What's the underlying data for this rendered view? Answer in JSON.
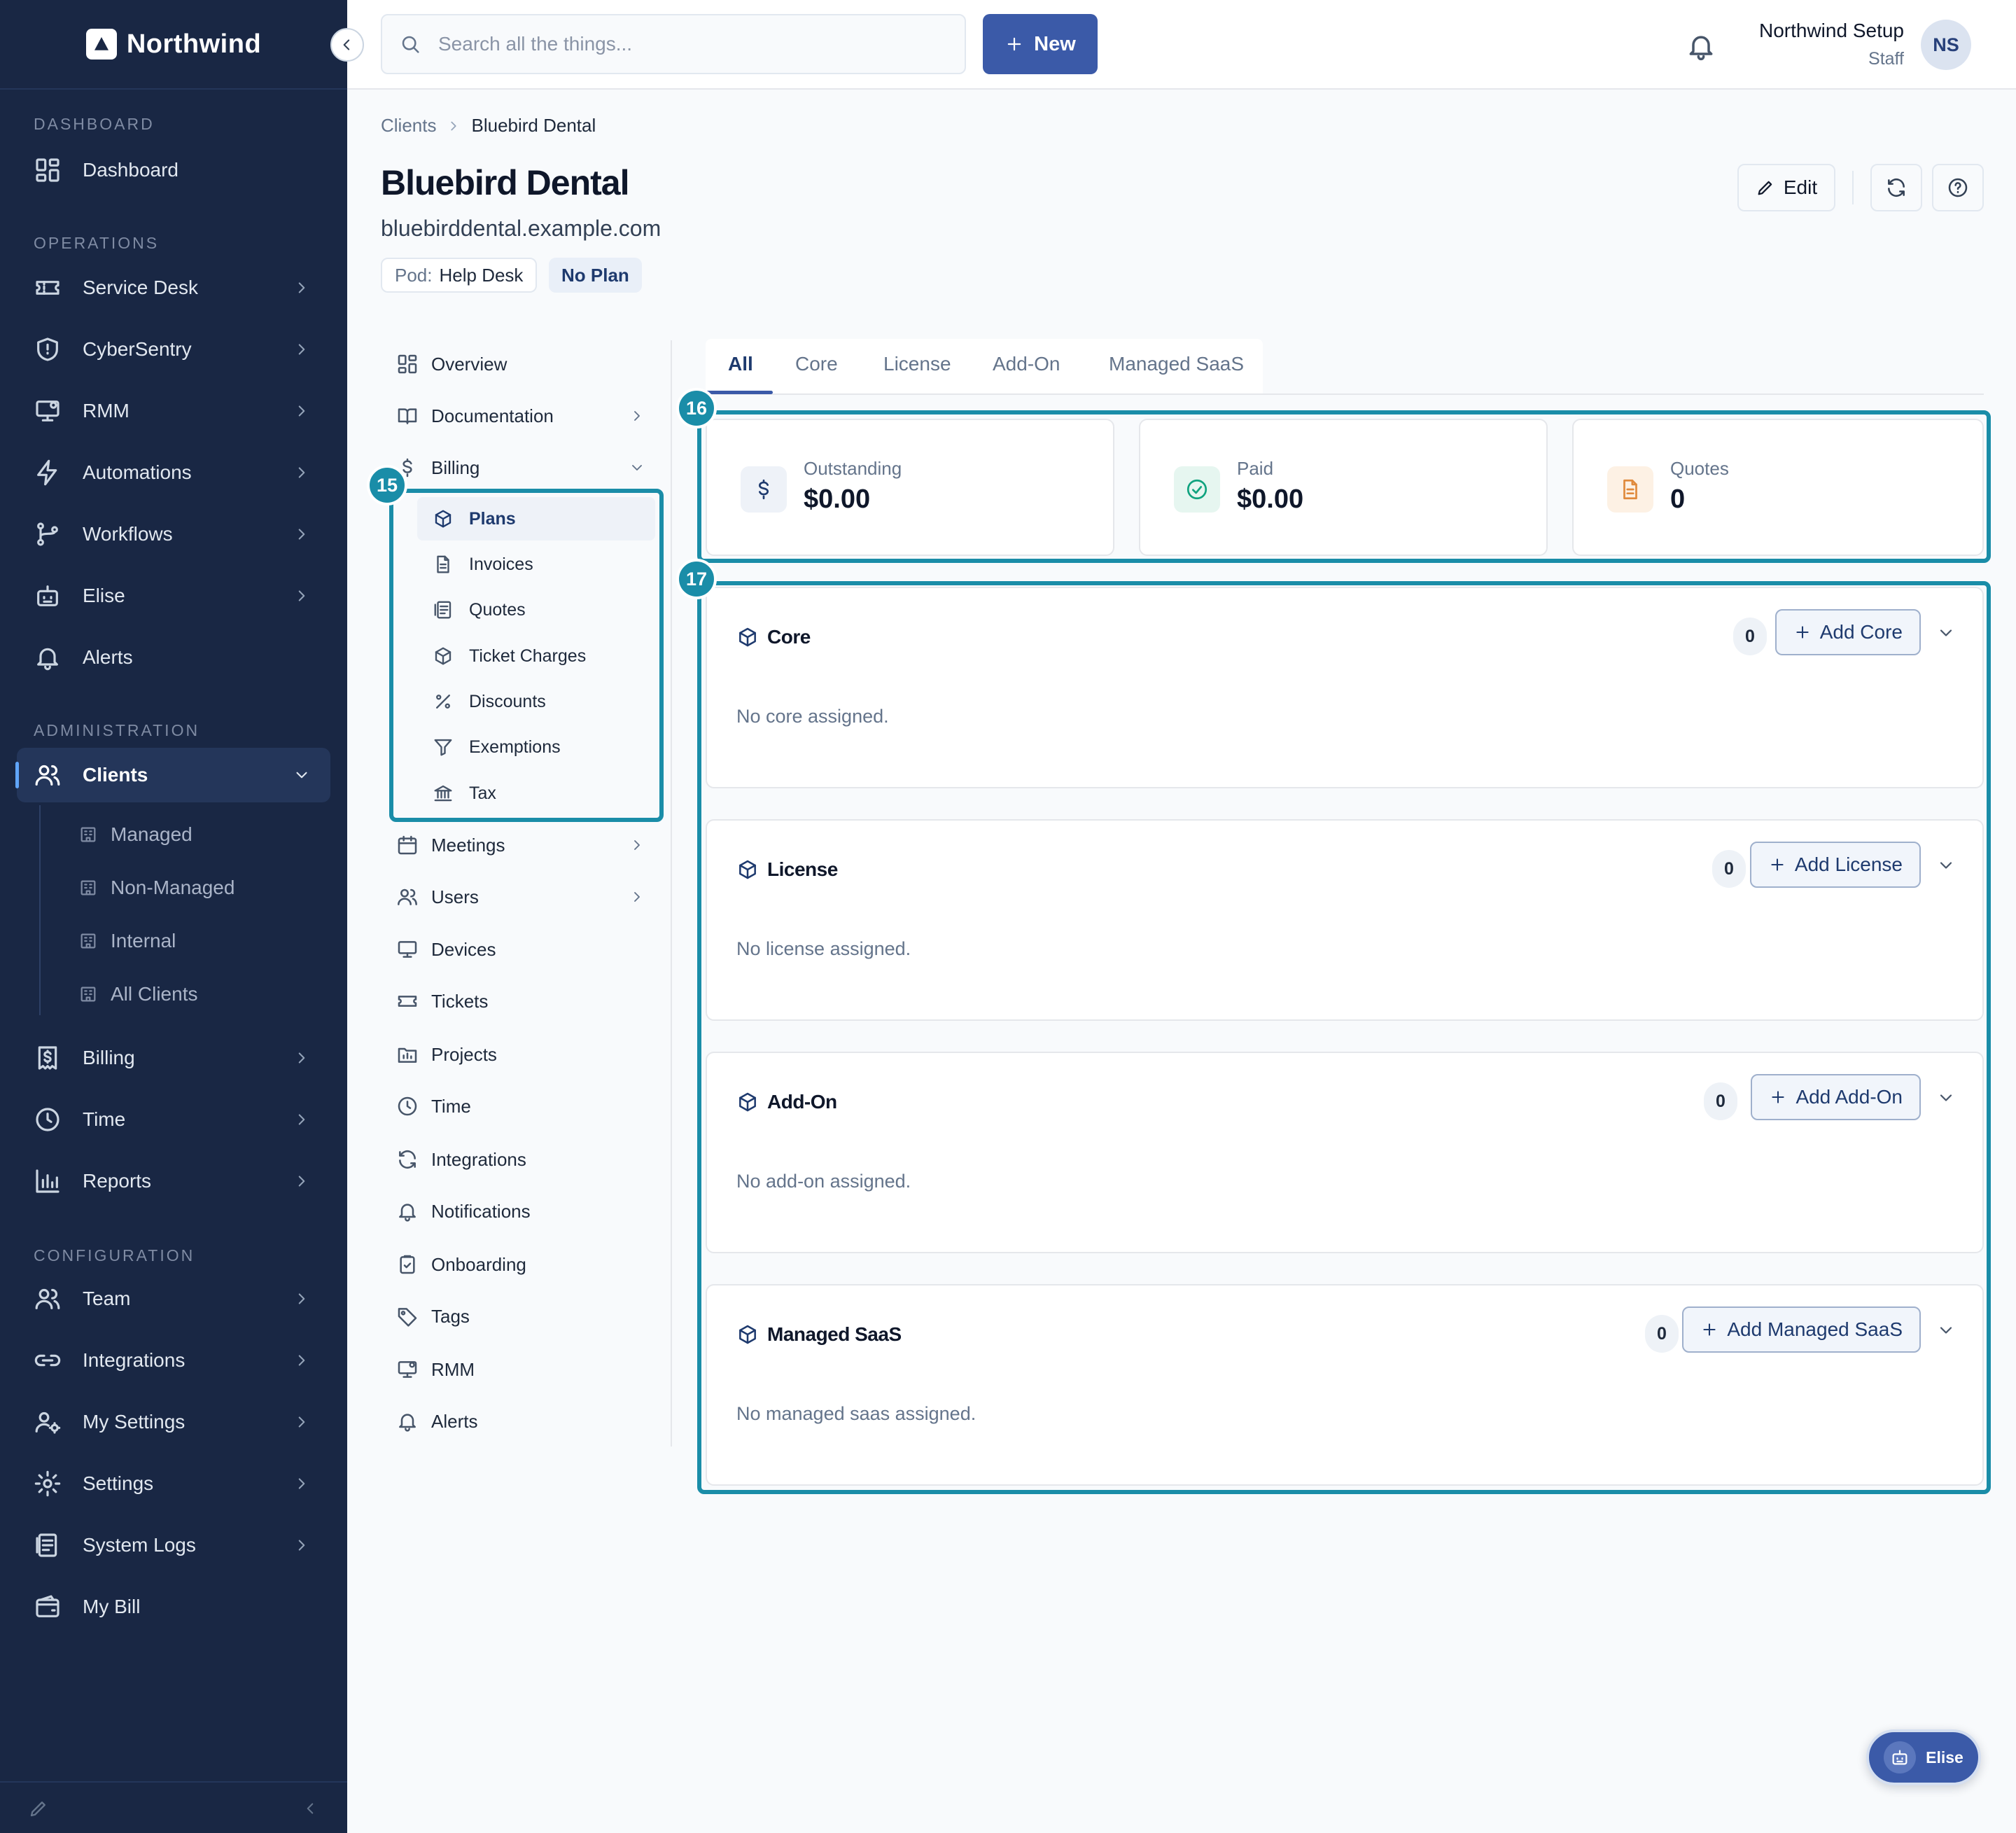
{
  "app": {
    "name": "Northwind"
  },
  "sidebar": {
    "sections": {
      "dashboard": "DASHBOARD",
      "operations": "OPERATIONS",
      "administration": "ADMINISTRATION",
      "configuration": "CONFIGURATION"
    },
    "items": {
      "dashboard": "Dashboard",
      "service_desk": "Service Desk",
      "cybersentry": "CyberSentry",
      "rmm": "RMM",
      "automations": "Automations",
      "workflows": "Workflows",
      "elise": "Elise",
      "alerts": "Alerts",
      "clients": "Clients",
      "billing": "Billing",
      "time": "Time",
      "reports": "Reports",
      "team": "Team",
      "integrations": "Integrations",
      "my_settings": "My Settings",
      "settings": "Settings",
      "system_logs": "System Logs",
      "my_bill": "My Bill"
    },
    "client_subitems": [
      "Managed",
      "Non-Managed",
      "Internal",
      "All Clients"
    ]
  },
  "topbar": {
    "search_placeholder": "Search all the things...",
    "new_label": "New",
    "user_name": "Northwind Setup",
    "user_role": "Staff",
    "user_initials": "NS"
  },
  "breadcrumb": {
    "root": "Clients",
    "current": "Bluebird Dental"
  },
  "client": {
    "name": "Bluebird Dental",
    "domain": "bluebirddental.example.com",
    "pod_key": "Pod:",
    "pod_value": "Help Desk",
    "plan": "No Plan"
  },
  "header_actions": {
    "edit": "Edit"
  },
  "client_nav": {
    "overview": "Overview",
    "documentation": "Documentation",
    "billing": "Billing",
    "billing_sub": [
      "Plans",
      "Invoices",
      "Quotes",
      "Ticket Charges",
      "Discounts",
      "Exemptions",
      "Tax"
    ],
    "meetings": "Meetings",
    "users": "Users",
    "devices": "Devices",
    "tickets": "Tickets",
    "projects": "Projects",
    "time": "Time",
    "integrations": "Integrations",
    "notifications": "Notifications",
    "onboarding": "Onboarding",
    "tags": "Tags",
    "rmm": "RMM",
    "alerts": "Alerts"
  },
  "annotations": {
    "a15": "15",
    "a16": "16",
    "a17": "17"
  },
  "tabs": [
    "All",
    "Core",
    "License",
    "Add-On",
    "Managed SaaS"
  ],
  "stats": [
    {
      "label": "Outstanding",
      "value": "$0.00"
    },
    {
      "label": "Paid",
      "value": "$0.00"
    },
    {
      "label": "Quotes",
      "value": "0"
    }
  ],
  "plan_sections": [
    {
      "title": "Core",
      "count": "0",
      "add_label": "Add Core",
      "empty": "No core assigned."
    },
    {
      "title": "License",
      "count": "0",
      "add_label": "Add License",
      "empty": "No license assigned."
    },
    {
      "title": "Add-On",
      "count": "0",
      "add_label": "Add Add-On",
      "empty": "No add-on assigned."
    },
    {
      "title": "Managed SaaS",
      "count": "0",
      "add_label": "Add Managed SaaS",
      "empty": "No managed saas assigned."
    }
  ],
  "elise_fab": "Elise",
  "colors": {
    "sidebar": "#192744",
    "accent": "#3b5aa8",
    "annotation": "#1a8da8"
  }
}
